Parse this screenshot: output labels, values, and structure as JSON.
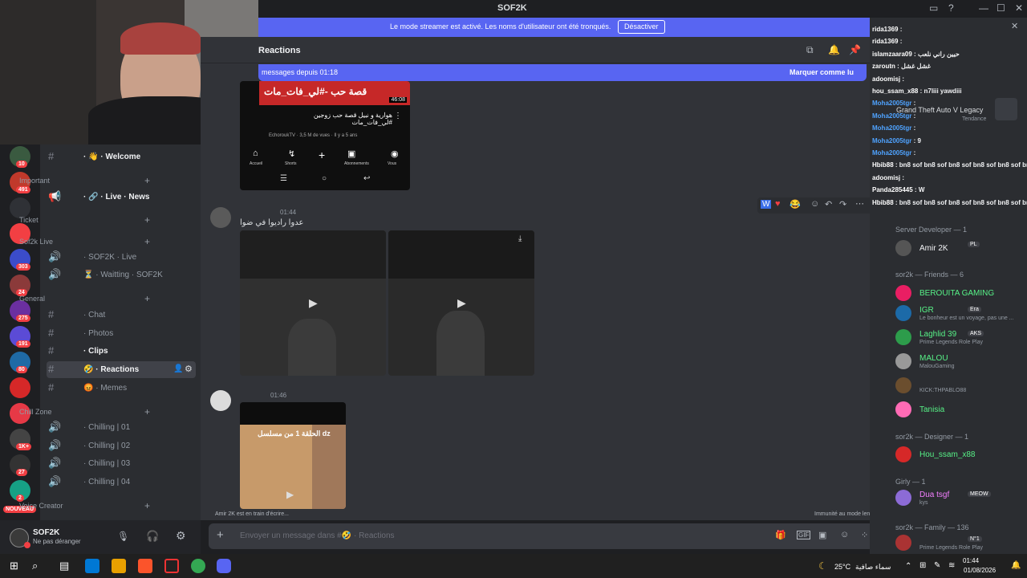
{
  "window": {
    "title": "SOF2K"
  },
  "streamer_bar": {
    "text": "Le mode streamer est activé. Les noms d'utilisateur ont été tronqués.",
    "button": "Désactiver"
  },
  "channel_header": {
    "title": "Reactions"
  },
  "new_messages": {
    "label": "messages depuis 01:18",
    "mark_read": "Marquer comme lu"
  },
  "guild_badges": [
    "10",
    "491",
    "303",
    "24",
    "275",
    "191",
    "80",
    "1K+",
    "27",
    "2",
    "NOUVEAU"
  ],
  "channels": [
    {
      "type": "text",
      "label": "· 👋 · Welcome",
      "bold": true
    },
    {
      "type": "category",
      "label": "Important"
    },
    {
      "type": "announce",
      "label": "· 🔗 · Live · News",
      "bold": true
    },
    {
      "type": "category",
      "label": "Ticket"
    },
    {
      "type": "category",
      "label": "Sof2k Live"
    },
    {
      "type": "voice",
      "label": "· SOF2K · Live"
    },
    {
      "type": "voice",
      "label": "⏳ · Waitting · SOF2K"
    },
    {
      "type": "category",
      "label": "General"
    },
    {
      "type": "text",
      "label": "· Chat"
    },
    {
      "type": "text",
      "label": "· Photos"
    },
    {
      "type": "text",
      "label": "· Clips",
      "bold": true
    },
    {
      "type": "text",
      "label": "🤣 · Reactions",
      "active": true
    },
    {
      "type": "text",
      "label": "😡 · Memes"
    },
    {
      "type": "category",
      "label": "Chill Zone"
    },
    {
      "type": "voice",
      "label": "· Chilling | 01"
    },
    {
      "type": "voice",
      "label": "· Chilling | 02"
    },
    {
      "type": "voice",
      "label": "· Chilling | 03"
    },
    {
      "type": "voice",
      "label": "· Chilling | 04"
    },
    {
      "type": "category",
      "label": "Voice Creator"
    }
  ],
  "user": {
    "name": "SOF2K",
    "status": "Ne pas déranger"
  },
  "messages": [
    {
      "time": "01:44",
      "text": "عدوا راديوا في ضوا"
    },
    {
      "time": "01:46",
      "text": ""
    }
  ],
  "youtube_embed": {
    "title": "هوارية و نبيل قصة حب زوجين #لي_فات_مات",
    "meta": "EchoroukTV · 3,5 M de vues · Il y a 5 ans",
    "duration": "46:08",
    "thumb_text": "قصة حب -#لي_فات_مات",
    "nav": [
      "Accueil",
      "Shorts",
      "Abonnements",
      "Vous"
    ]
  },
  "video_caption": "الحلقة 1 من مسلسل dz",
  "typing": "Amir 2K est en train d'écrire...",
  "slowmode": "Immunité au mode lent",
  "composer": {
    "placeholder": "Envoyer un message dans #🤣 · Reactions"
  },
  "stream_chat": [
    {
      "user": "rida1369",
      "msg": "",
      "color": "#ffffff"
    },
    {
      "user": "rida1369",
      "msg": "",
      "color": "#ffffff"
    },
    {
      "user": "islamzaara09",
      "msg": "حيين راني نلعب",
      "color": "#ffffff"
    },
    {
      "user": "zaroutn",
      "msg": "غشل غشل",
      "color": "#ffffff"
    },
    {
      "user": "adoomisj",
      "msg": "",
      "color": "#ffffff"
    },
    {
      "user": "hou_ssam_x88",
      "msg": "n7liii yawdiii",
      "color": "#ffffff"
    },
    {
      "user": "Moha2005tgr",
      "msg": "",
      "color": "#4fa3ff"
    },
    {
      "user": "Moha2005tgr",
      "msg": "",
      "color": "#4fa3ff"
    },
    {
      "user": "Moha2005tgr",
      "msg": "",
      "color": "#4fa3ff"
    },
    {
      "user": "Moha2005tgr",
      "msg": "9",
      "color": "#4fa3ff"
    },
    {
      "user": "Moha2005tgr",
      "msg": "",
      "color": "#4fa3ff"
    },
    {
      "user": "Hbib88",
      "msg": "bn8 sof bn8 sof bn8 sof bn8 sof bn8 sof bn8 sof",
      "color": "#ffffff"
    },
    {
      "user": "adoomisj",
      "msg": "",
      "color": "#ffffff"
    },
    {
      "user": "Panda285445",
      "msg": "W",
      "color": "#ffffff"
    },
    {
      "user": "Hbib88",
      "msg": "bn8 sof bn8 sof bn8 sof bn8 sof bn8 sof bn8 sof",
      "color": "#ffffff"
    }
  ],
  "activity": {
    "game": "Grand Theft Auto V Legacy",
    "tag": "Tendance"
  },
  "members": {
    "categories": [
      {
        "label": "Server Developer — 1"
      },
      {
        "label": "sor2k — Friends — 6"
      },
      {
        "label": "sor2k — Designer — 1"
      },
      {
        "label": "Girly — 1"
      },
      {
        "label": "sor2k — Family — 136"
      }
    ],
    "list": [
      {
        "name": "Amir 2K",
        "sub": "",
        "tag": "PL",
        "color": "#f2f3f5"
      },
      {
        "name": "BEROUITA GAMING",
        "sub": "",
        "tag": "",
        "color": "#57f287"
      },
      {
        "name": "IGR",
        "sub": "Le bonheur est un voyage, pas une ...",
        "tag": "Era",
        "color": "#57f287"
      },
      {
        "name": "Laghlid 39",
        "sub": "Prime Legends Role Play",
        "tag": "AKS",
        "color": "#57f287"
      },
      {
        "name": "MALOU",
        "sub": "MalouGaming",
        "tag": "",
        "color": "#57f287"
      },
      {
        "name": "",
        "sub": "KICK:THPABLO88",
        "tag": "",
        "color": "#57f287"
      },
      {
        "name": "Tanisia",
        "sub": "",
        "tag": "",
        "color": "#57f287"
      },
      {
        "name": "Hou_ssam_x88",
        "sub": "",
        "tag": "",
        "color": "#57f287"
      },
      {
        "name": "Dua tsgf",
        "sub": "kys",
        "tag": "MEOW",
        "color": "#f47fff"
      },
      {
        "name": "",
        "sub": "Prime Legends Role Play",
        "tag": "N°1",
        "color": "#f47fff"
      }
    ]
  },
  "taskbar": {
    "weather": "25°C",
    "weather_desc": "سماء صافية",
    "time": "01:44",
    "date": "01/08/2026"
  },
  "colors": {
    "accent": "#5865f2",
    "dnd": "#f23f43",
    "online": "#23a55a"
  }
}
